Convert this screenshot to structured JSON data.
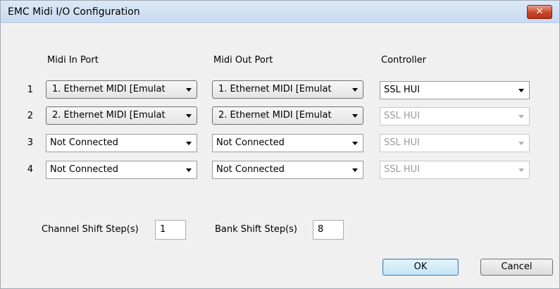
{
  "window": {
    "title": "EMC Midi I/O Configuration",
    "close_label": "✕"
  },
  "headers": {
    "midi_in": "Midi In Port",
    "midi_out": "Midi Out Port",
    "controller": "Controller"
  },
  "rows": [
    {
      "num": "1",
      "midi_in": "1. Ethernet MIDI [Emulat",
      "midi_out": "1. Ethernet MIDI [Emulat",
      "controller": "SSL HUI"
    },
    {
      "num": "2",
      "midi_in": "2. Ethernet MIDI [Emulat",
      "midi_out": "2. Ethernet MIDI [Emulat",
      "controller": "SSL HUI"
    },
    {
      "num": "3",
      "midi_in": "Not Connected",
      "midi_out": "Not Connected",
      "controller": "SSL HUI"
    },
    {
      "num": "4",
      "midi_in": "Not Connected",
      "midi_out": "Not Connected",
      "controller": "SSL HUI"
    }
  ],
  "channel_shift": {
    "label": "Channel Shift Step(s)",
    "value": "1"
  },
  "bank_shift": {
    "label": "Bank Shift Step(s)",
    "value": "8"
  },
  "buttons": {
    "ok": "OK",
    "cancel": "Cancel"
  },
  "colors": {
    "titlebar": "#c9dbf1",
    "close_button": "#c9462a",
    "dialog_bg": "#f0f0f0",
    "ok_border": "#3c7fb1"
  }
}
